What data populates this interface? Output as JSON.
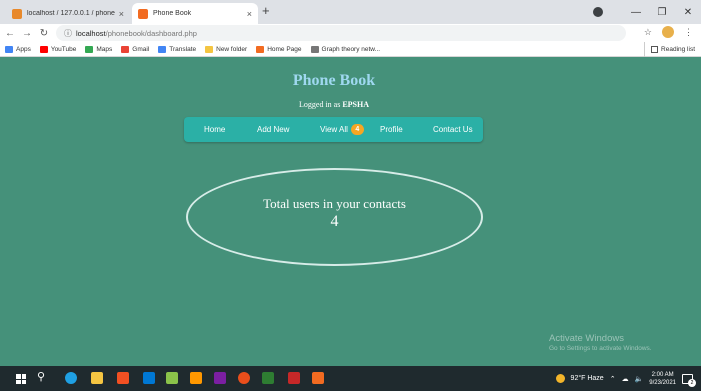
{
  "browser": {
    "tabs": [
      {
        "label": "localhost / 127.0.0.1 / phonebo",
        "active": false,
        "favicon_color": "#e8892b"
      },
      {
        "label": "Phone Book",
        "active": true,
        "favicon_color": "#f26b21"
      }
    ],
    "tab_close": "×",
    "new_tab": "+",
    "url_host": "localhost",
    "url_path": "/phonebook/dashboard.php",
    "bookmarks": [
      {
        "label": "Apps",
        "color": "#4285f4"
      },
      {
        "label": "YouTube",
        "color": "#ff0000"
      },
      {
        "label": "Maps",
        "color": "#34a853"
      },
      {
        "label": "Gmail",
        "color": "#ea4335"
      },
      {
        "label": "Translate",
        "color": "#4285f4"
      },
      {
        "label": "New folder",
        "color": "#f4c542"
      },
      {
        "label": "Home Page",
        "color": "#f26b21"
      },
      {
        "label": "Graph theory netw...",
        "color": "#777777"
      }
    ],
    "reading_list": "Reading list"
  },
  "page": {
    "title": "Phone Book",
    "logged_in_prefix": "Logged in as",
    "logged_in_user": "EPSHA",
    "nav": {
      "home": "Home",
      "add_new": "Add New",
      "view_all": "View All",
      "view_all_count": "4",
      "profile": "Profile",
      "contact_us": "Contact Us"
    },
    "total_label": "Total users in your contacts",
    "total_count": "4",
    "watermark_title": "Activate Windows",
    "watermark_sub": "Go to Settings to activate Windows."
  },
  "taskbar": {
    "weather": "92°F  Haze",
    "time": "2:00 AM",
    "date": "9/23/2021",
    "notifications": "2"
  },
  "colors": {
    "page_bg": "#45917a",
    "navbar_bg": "#2bb0a6",
    "title": "#9fd8f0",
    "badge": "#f6a623"
  }
}
